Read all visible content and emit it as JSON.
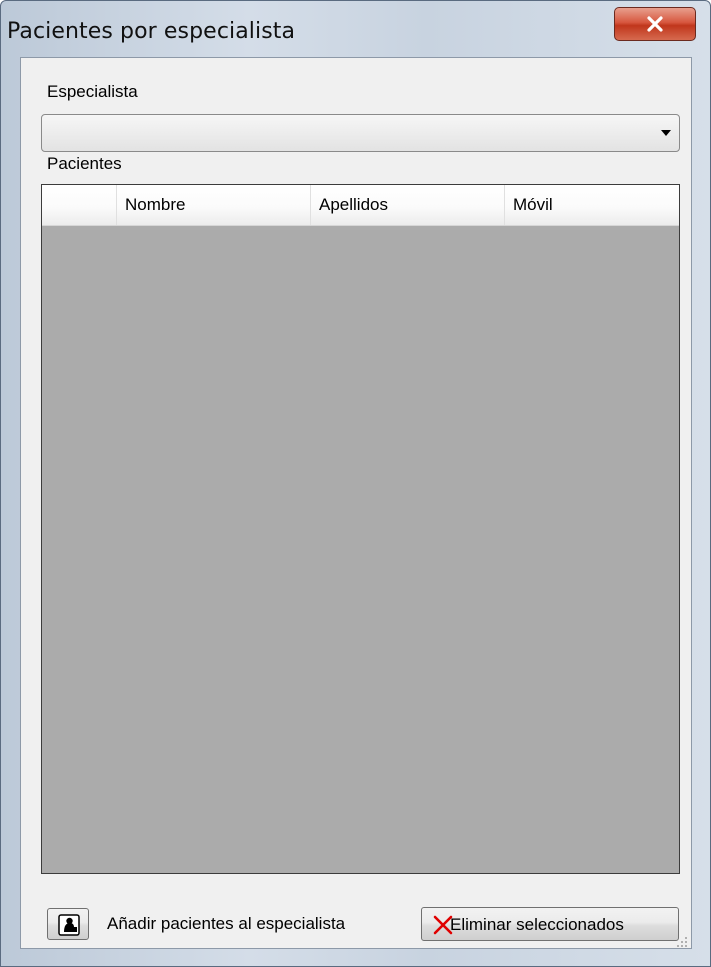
{
  "window": {
    "title": "Pacientes por especialista"
  },
  "specialist": {
    "label": "Especialista",
    "selected_value": ""
  },
  "patients": {
    "label": "Pacientes",
    "columns": [
      "",
      "Nombre",
      "Apellidos",
      "Móvil"
    ],
    "rows": []
  },
  "actions": {
    "add_label": "Añadir pacientes al especialista",
    "delete_label": "Eliminar seleccionados"
  },
  "icons": {
    "close": "close-icon",
    "add": "add-patient-icon",
    "delete": "delete-x-icon",
    "dropdown": "chevron-down-icon",
    "grip": "resize-grip-icon"
  },
  "colors": {
    "close_button": "#c8432a",
    "grid_background": "#ababab",
    "delete_icon": "#e00000"
  }
}
